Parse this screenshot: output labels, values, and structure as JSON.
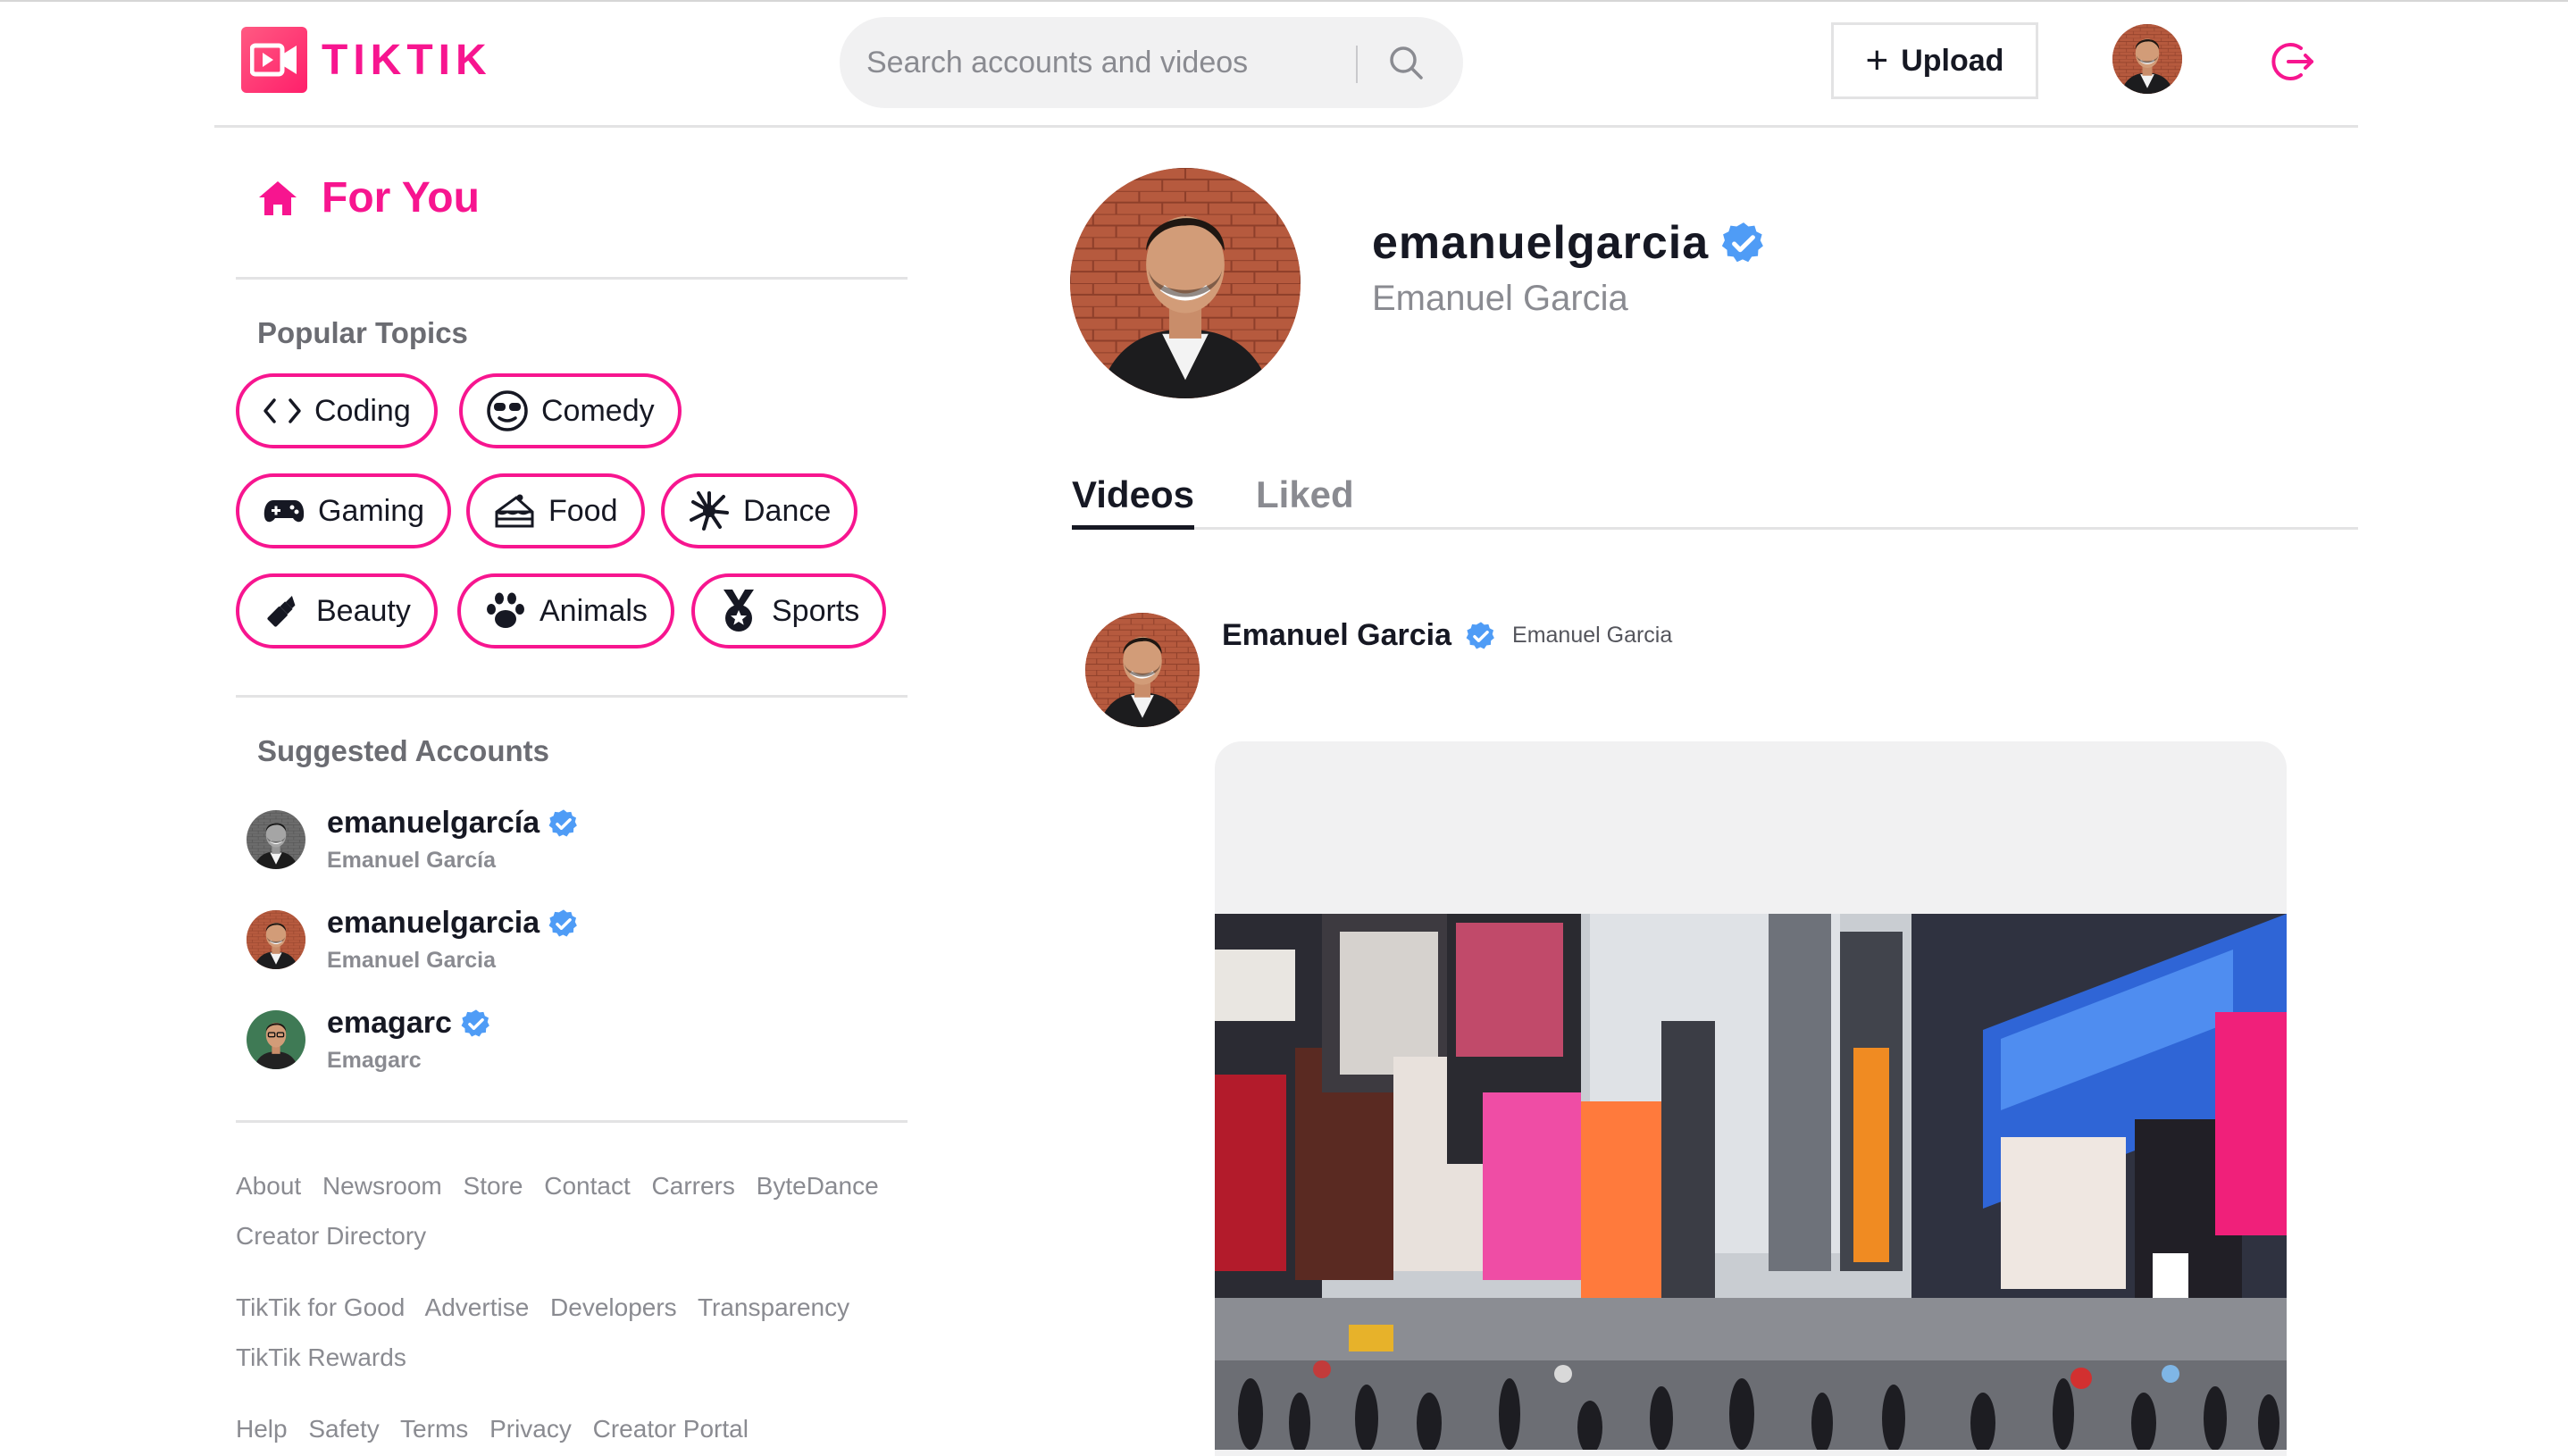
{
  "brand": {
    "name": "TIKTIK",
    "color": "#f7158f"
  },
  "search": {
    "placeholder": "Search accounts and videos",
    "value": ""
  },
  "header": {
    "upload_label": "Upload"
  },
  "sidebar": {
    "for_you_label": "For You",
    "popular_topics_title": "Popular Topics",
    "topics": [
      {
        "label": "Coding",
        "icon": "code-icon"
      },
      {
        "label": "Comedy",
        "icon": "sunglasses-face-icon"
      },
      {
        "label": "Gaming",
        "icon": "gamepad-icon"
      },
      {
        "label": "Food",
        "icon": "cake-icon"
      },
      {
        "label": "Dance",
        "icon": "dance-icon"
      },
      {
        "label": "Beauty",
        "icon": "lipstick-icon"
      },
      {
        "label": "Animals",
        "icon": "paw-icon"
      },
      {
        "label": "Sports",
        "icon": "medal-icon"
      }
    ],
    "suggested_title": "Suggested Accounts",
    "accounts": [
      {
        "username": "emanuelgarcía",
        "name": "Emanuel García"
      },
      {
        "username": "emanuelgarcia",
        "name": "Emanuel Garcia"
      },
      {
        "username": "emagarc",
        "name": "Emagarc"
      }
    ],
    "footer": [
      [
        "About",
        "Newsroom",
        "Store",
        "Contact",
        "Carrers",
        "ByteDance",
        "Creator Directory"
      ],
      [
        "TikTik for Good",
        "Advertise",
        "Developers",
        "Transparency",
        "TikTik Rewards"
      ],
      [
        "Help",
        "Safety",
        "Terms",
        "Privacy",
        "Creator Portal"
      ]
    ]
  },
  "profile": {
    "username": "emanuelgarcia",
    "name": "Emanuel Garcia",
    "verified": true,
    "tabs": [
      "Videos",
      "Liked"
    ],
    "active_tab": "Videos"
  },
  "post": {
    "name": "Emanuel Garcia",
    "handle": "Emanuel Garcia"
  },
  "colors": {
    "accent": "#f7158f",
    "verified": "#4f9cf6",
    "muted": "#8a8b91"
  }
}
